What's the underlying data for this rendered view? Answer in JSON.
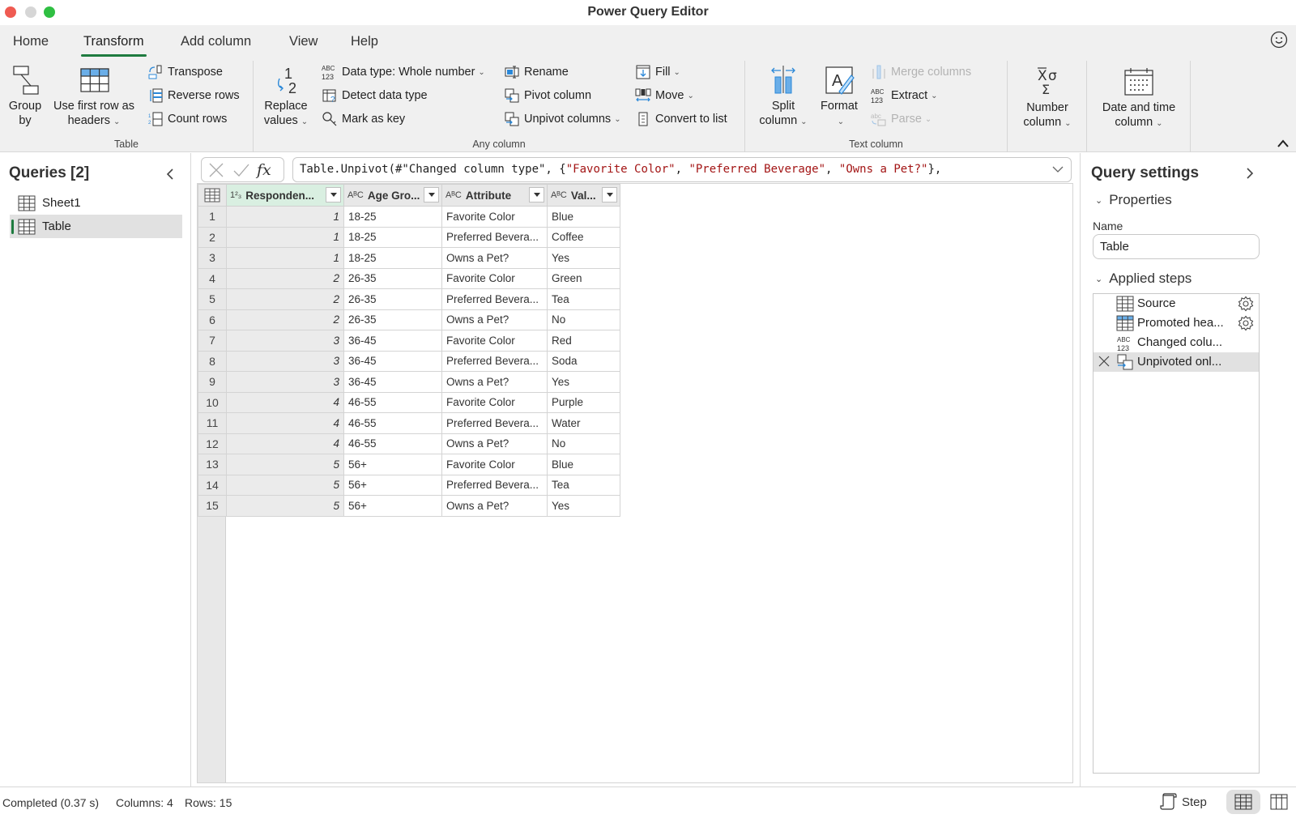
{
  "window": {
    "title": "Power Query Editor"
  },
  "menu": {
    "tabs": [
      {
        "label": "Home"
      },
      {
        "label": "Transform",
        "active": true
      },
      {
        "label": "Add column"
      },
      {
        "label": "View"
      },
      {
        "label": "Help"
      }
    ],
    "feedback_icon": "smiley-icon"
  },
  "ribbon": {
    "groups": {
      "table": {
        "label": "Table",
        "group_by": [
          "Group",
          "by"
        ],
        "use_first_row": [
          "Use first row as",
          "headers"
        ],
        "transpose": "Transpose",
        "reverse_rows": "Reverse rows",
        "count_rows": "Count rows"
      },
      "any_column": {
        "label": "Any column",
        "replace_values": [
          "Replace",
          "values"
        ],
        "data_type": "Data type: Whole number",
        "detect_data_type": "Detect data type",
        "mark_as_key": "Mark as key",
        "rename": "Rename",
        "pivot_column": "Pivot column",
        "unpivot_columns": "Unpivot columns",
        "fill": "Fill",
        "move": "Move",
        "convert_to_list": "Convert to list"
      },
      "text_column": {
        "label": "Text column",
        "split_column": [
          "Split",
          "column"
        ],
        "format": "Format",
        "merge_columns": "Merge columns",
        "extract": "Extract",
        "parse": "Parse"
      },
      "number_column": {
        "label": [
          "Number",
          "column"
        ]
      },
      "date_time_column": {
        "label": [
          "Date and time",
          "column"
        ]
      }
    }
  },
  "queries": {
    "title": "Queries [2]",
    "items": [
      {
        "label": "Sheet1",
        "selected": false
      },
      {
        "label": "Table",
        "selected": true
      }
    ]
  },
  "formula_bar": {
    "prefix": "Table.Unpivot(#\"Changed column type\", {",
    "strings": [
      "\"Favorite Color\"",
      "\"Preferred Beverage\"",
      "\"Owns a Pet?\""
    ],
    "separator": ", ",
    "suffix": "},",
    "fx_label": "fx"
  },
  "grid": {
    "columns": [
      {
        "type_icon": "1²₃",
        "label": "Responden...",
        "selected": true
      },
      {
        "type_icon": "AᴮC",
        "label": "Age Gro..."
      },
      {
        "type_icon": "AᴮC",
        "label": "Attribute"
      },
      {
        "type_icon": "AᴮC",
        "label": "Val..."
      }
    ],
    "rows": [
      [
        "1",
        "18-25",
        "Favorite Color",
        "Blue"
      ],
      [
        "1",
        "18-25",
        "Preferred Bevera...",
        "Coffee"
      ],
      [
        "1",
        "18-25",
        "Owns a Pet?",
        "Yes"
      ],
      [
        "2",
        "26-35",
        "Favorite Color",
        "Green"
      ],
      [
        "2",
        "26-35",
        "Preferred Bevera...",
        "Tea"
      ],
      [
        "2",
        "26-35",
        "Owns a Pet?",
        "No"
      ],
      [
        "3",
        "36-45",
        "Favorite Color",
        "Red"
      ],
      [
        "3",
        "36-45",
        "Preferred Bevera...",
        "Soda"
      ],
      [
        "3",
        "36-45",
        "Owns a Pet?",
        "Yes"
      ],
      [
        "4",
        "46-55",
        "Favorite Color",
        "Purple"
      ],
      [
        "4",
        "46-55",
        "Preferred Bevera...",
        "Water"
      ],
      [
        "4",
        "46-55",
        "Owns a Pet?",
        "No"
      ],
      [
        "5",
        "56+",
        "Favorite Color",
        "Blue"
      ],
      [
        "5",
        "56+",
        "Preferred Bevera...",
        "Tea"
      ],
      [
        "5",
        "56+",
        "Owns a Pet?",
        "Yes"
      ]
    ]
  },
  "settings": {
    "title": "Query settings",
    "properties_label": "Properties",
    "name_label": "Name",
    "name_value": "Table",
    "applied_steps_label": "Applied steps",
    "steps": [
      {
        "label": "Source",
        "icon": "table-icon",
        "has_gear": true
      },
      {
        "label": "Promoted hea...",
        "icon": "header-table-icon",
        "has_gear": true
      },
      {
        "label": "Changed colu...",
        "icon": "abc-123-icon",
        "has_gear": false
      },
      {
        "label": "Unpivoted onl...",
        "icon": "unpivot-icon",
        "has_gear": false,
        "selected": true
      }
    ]
  },
  "status": {
    "completed": "Completed (0.37 s)",
    "columns": "Columns: 4",
    "rows": "Rows: 15",
    "step_label": "Step"
  },
  "colors": {
    "accent_green": "#1e7b3f",
    "selected_column_header": "#d9efe1",
    "formula_string": "#a31515",
    "icon_blue": "#2b88d8"
  }
}
